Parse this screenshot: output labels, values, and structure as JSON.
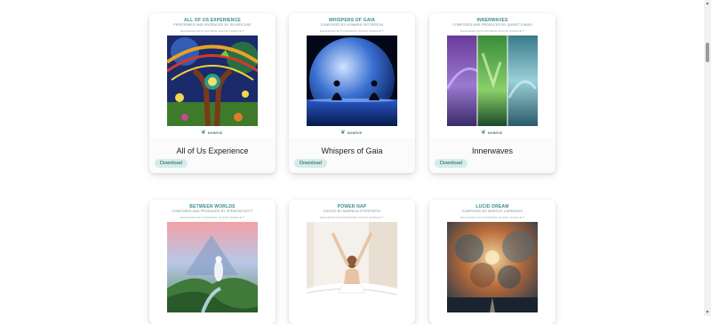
{
  "brand_label": "MONROE",
  "download_label": "Download",
  "cards": [
    {
      "cover_title": "ALL OF US EXPERIENCE",
      "cover_credit": "PERFORMED AND PRODUCED BY SILVERCUSE",
      "cover_enhanced": "ENHANCED WITH MONROE SOUND SCIENCE™",
      "name": "All of Us Experience"
    },
    {
      "cover_title": "WHISPERS OF GAIA",
      "cover_credit": "COMPOSED BY HOWARD PATTERSON",
      "cover_enhanced": "ENHANCED WITH MONROE SOUND SCIENCE™",
      "name": "Whispers of Gaia"
    },
    {
      "cover_title": "INNERWAVES",
      "cover_credit": "COMPOSED AND PRODUCED BY QUINST EVANS",
      "cover_enhanced": "ENHANCED WITH MONROE SOUND SCIENCE™",
      "name": "Innerwaves"
    },
    {
      "cover_title": "BETWEEN WORLDS",
      "cover_credit": "COMPOSED AND PRODUCED BY SPENCER BOTT",
      "cover_enhanced": "ENHANCED WITH MONROE SOUND SCIENCE™"
    },
    {
      "cover_title": "POWER NAP",
      "cover_credit": "VOICED BY MARNICA STORFORTH",
      "cover_enhanced": "ENHANCED WITH MONROE SOUND SCIENCE™"
    },
    {
      "cover_title": "LUCID DREAM",
      "cover_credit": "COMPOSED BY MARCUS CARRASCO",
      "cover_enhanced": "ENHANCED WITH MONROE SOUND SCIENCE™"
    }
  ],
  "colors": {
    "accent_teal": "#3a8a8a",
    "download_bg": "#d3ecea",
    "download_text": "#1c5a5a"
  },
  "icons": {
    "brand_logo": "monroe-leaf-logo",
    "scroll_up": "scroll-up-arrow",
    "scroll_down": "scroll-down-arrow"
  }
}
